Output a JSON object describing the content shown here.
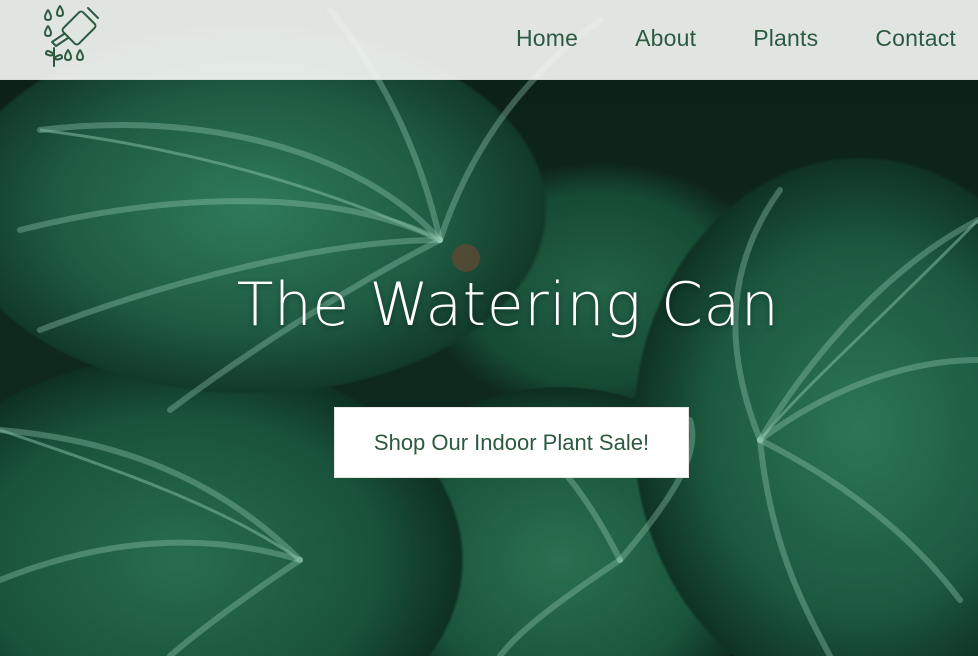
{
  "site": {
    "title": "The Watering Can",
    "logo_icon": "watering-can-icon"
  },
  "nav": {
    "items": [
      {
        "label": "Home"
      },
      {
        "label": "About"
      },
      {
        "label": "Plants"
      },
      {
        "label": "Contact"
      }
    ]
  },
  "hero": {
    "cta_label": "Shop Our Indoor Plant Sale!",
    "background": "tropical-leaves-photo"
  },
  "colors": {
    "accent_green": "#2b5a3f",
    "header_bg": "#f4f6f3",
    "button_bg": "#ffffff",
    "title_text": "#ffffff"
  }
}
